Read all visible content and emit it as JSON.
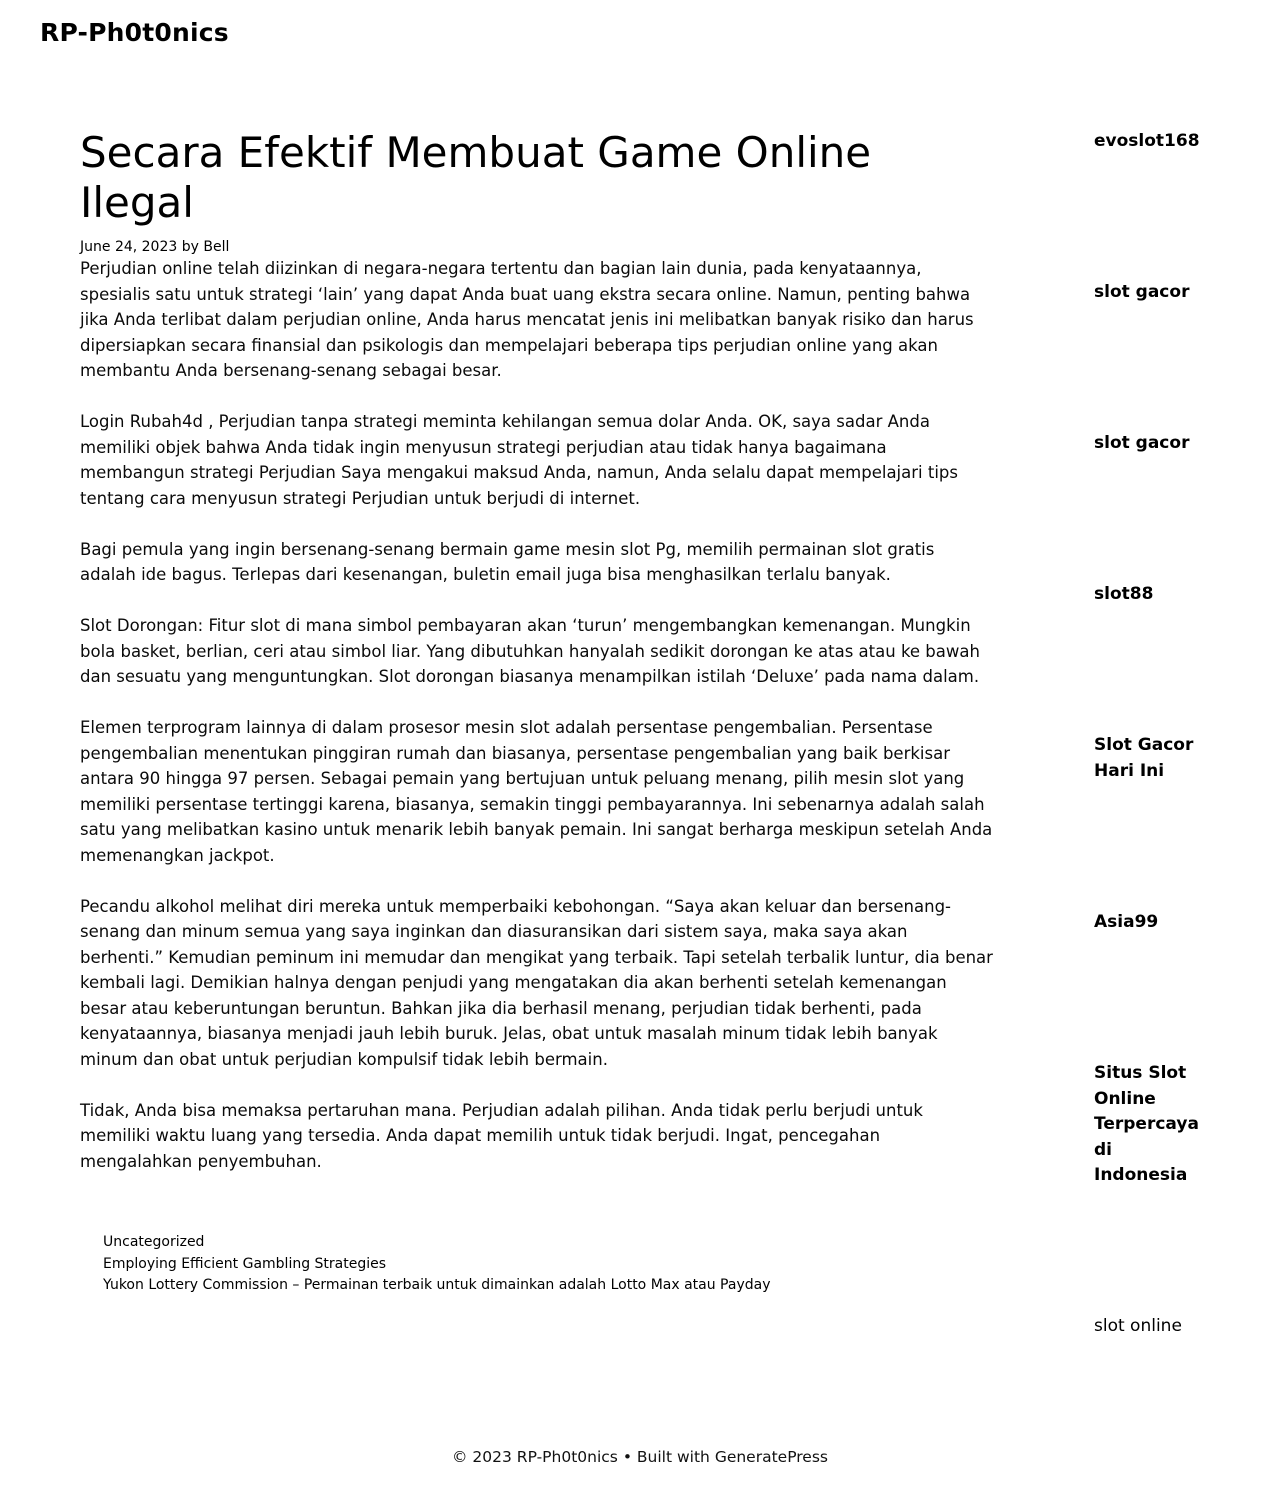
{
  "site": {
    "title": "RP-Ph0t0nics"
  },
  "post": {
    "title": "Secara Efektif Membuat Game Online Ilegal",
    "date": "June 24, 2023",
    "by": "by",
    "author": "Bell",
    "paragraphs": [
      "Perjudian online telah diizinkan di negara-negara tertentu dan bagian lain dunia, pada kenyataannya, spesialis satu untuk strategi ‘lain’ yang dapat Anda buat uang ekstra secara online. Namun, penting bahwa jika Anda terlibat dalam perjudian online, Anda harus mencatat jenis ini melibatkan banyak risiko dan harus dipersiapkan secara finansial dan psikologis dan mempelajari beberapa tips perjudian online yang akan membantu Anda bersenang-senang sebagai besar.",
      "Login Rubah4d , Perjudian tanpa strategi meminta kehilangan semua dolar Anda. OK, saya sadar Anda memiliki objek bahwa Anda tidak ingin menyusun strategi perjudian atau tidak hanya bagaimana membangun strategi Perjudian Saya mengakui maksud Anda, namun, Anda selalu dapat mempelajari tips tentang cara menyusun strategi Perjudian untuk berjudi di internet.",
      "Bagi pemula yang ingin bersenang-senang bermain game mesin slot Pg, memilih permainan slot gratis adalah ide bagus. Terlepas dari kesenangan, buletin email juga bisa menghasilkan terlalu banyak.",
      "Slot Dorongan: Fitur slot di mana simbol pembayaran akan ‘turun’ mengembangkan kemenangan. Mungkin bola basket, berlian, ceri atau simbol liar. Yang dibutuhkan hanyalah sedikit dorongan ke atas atau ke bawah dan sesuatu yang menguntungkan. Slot dorongan biasanya menampilkan istilah ‘Deluxe’ pada nama dalam.",
      "Elemen terprogram lainnya di dalam prosesor mesin slot adalah persentase pengembalian. Persentase pengembalian menentukan pinggiran rumah dan biasanya, persentase pengembalian yang baik berkisar antara 90 hingga 97 persen. Sebagai pemain yang bertujuan untuk peluang menang, pilih mesin slot yang memiliki persentase tertinggi karena, biasanya, semakin tinggi pembayarannya. Ini sebenarnya adalah salah satu yang melibatkan kasino untuk menarik lebih banyak pemain. Ini sangat berharga meskipun setelah Anda memenangkan jackpot.",
      "Pecandu alkohol melihat diri mereka untuk memperbaiki kebohongan. “Saya akan keluar dan bersenang-senang dan minum semua yang saya inginkan dan diasuransikan dari sistem saya, maka saya akan berhenti.” Kemudian peminum ini memudar dan mengikat yang terbaik. Tapi setelah terbalik luntur, dia benar kembali lagi. Demikian halnya dengan penjudi yang mengatakan dia akan berhenti setelah kemenangan besar atau keberuntungan beruntun. Bahkan jika dia berhasil menang, perjudian tidak berhenti, pada kenyataannya, biasanya menjadi jauh lebih buruk. Jelas, obat untuk masalah minum tidak lebih banyak minum dan obat untuk perjudian kompulsif tidak lebih bermain.",
      "Tidak, Anda bisa memaksa pertaruhan mana. Perjudian adalah pilihan. Anda tidak perlu berjudi untuk memiliki waktu luang yang tersedia. Anda dapat memilih untuk tidak berjudi. Ingat, pencegahan mengalahkan penyembuhan."
    ],
    "category": "Uncategorized",
    "prev_post": "Employing Efficient Gambling Strategies",
    "next_post": "Yukon Lottery Commission – Permainan terbaik untuk dimainkan adalah Lotto Max atau Payday"
  },
  "sidebar": {
    "links": [
      "evoslot168",
      "slot gacor",
      "slot gacor",
      "slot88",
      "Slot Gacor Hari Ini",
      "Asia99",
      "Situs Slot Online Terpercaya di Indonesia",
      "slot online"
    ]
  },
  "footer": {
    "copyright": "© 2023 RP-Ph0t0nics",
    "separator": "•",
    "built_with": "Built with",
    "theme": "GeneratePress"
  }
}
